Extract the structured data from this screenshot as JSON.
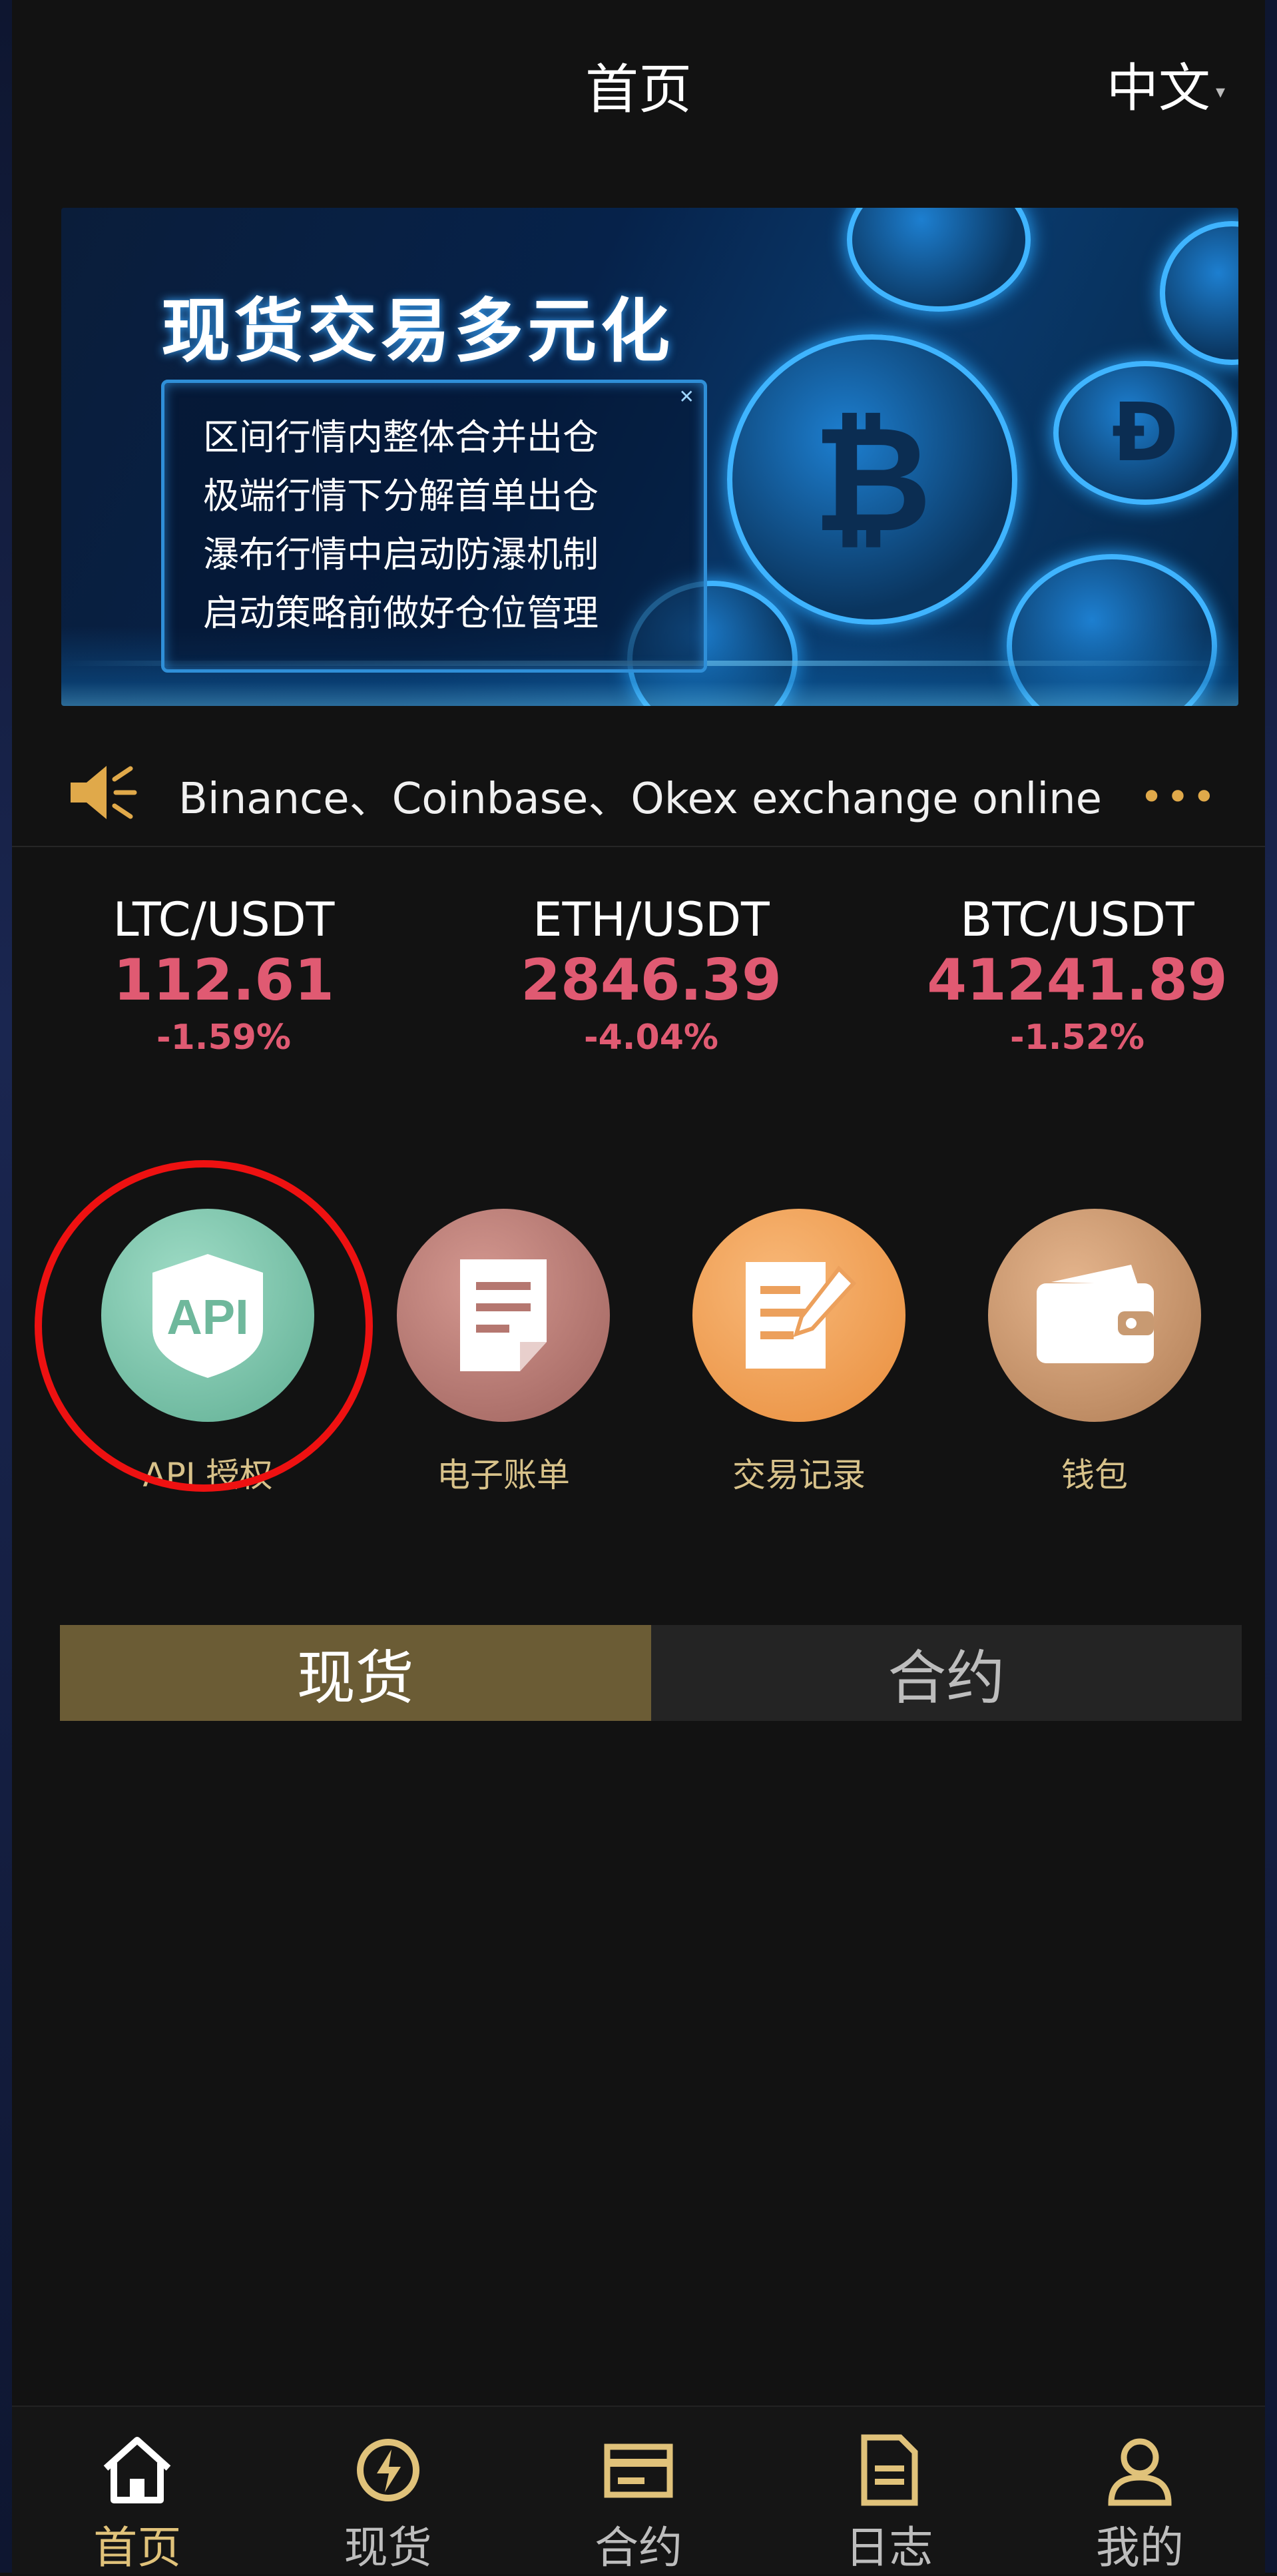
{
  "header": {
    "title": "首页",
    "language": "中文"
  },
  "banner": {
    "headline": "现货交易多元化",
    "lines": [
      "区间行情内整体合并出仓",
      "极端行情下分解首单出仓",
      "瀑布行情中启动防瀑机制",
      "启动策略前做好仓位管理"
    ]
  },
  "notice": {
    "text": "Binance、Coinbase、Okex exchange online",
    "more": "•••"
  },
  "tickers": [
    {
      "pair": "LTC/USDT",
      "price": "112.61",
      "change": "-1.59%"
    },
    {
      "pair": "ETH/USDT",
      "price": "2846.39",
      "change": "-4.04%"
    },
    {
      "pair": "BTC/USDT",
      "price": "41241.89",
      "change": "-1.52%"
    }
  ],
  "actions": [
    {
      "label": "API 授权",
      "icon": "api-shield-icon",
      "color": "#7fc4aa",
      "icon_text": "API"
    },
    {
      "label": "电子账单",
      "icon": "document-icon",
      "color": "#b87a73"
    },
    {
      "label": "交易记录",
      "icon": "edit-document-icon",
      "color": "#efa055"
    },
    {
      "label": "钱包",
      "icon": "wallet-icon",
      "color": "#c59468"
    }
  ],
  "tabs": [
    {
      "label": "现货",
      "active": true
    },
    {
      "label": "合约",
      "active": false
    }
  ],
  "bottom_nav": [
    {
      "label": "首页",
      "icon": "home-icon",
      "active": true
    },
    {
      "label": "现货",
      "icon": "spot-icon",
      "active": false
    },
    {
      "label": "合约",
      "icon": "contract-icon",
      "active": false
    },
    {
      "label": "日志",
      "icon": "log-icon",
      "active": false
    },
    {
      "label": "我的",
      "icon": "profile-icon",
      "active": false
    }
  ],
  "colors": {
    "accent_gold": "#e0c27a",
    "price_red": "#e05a72",
    "highlight": "#ee1111"
  }
}
